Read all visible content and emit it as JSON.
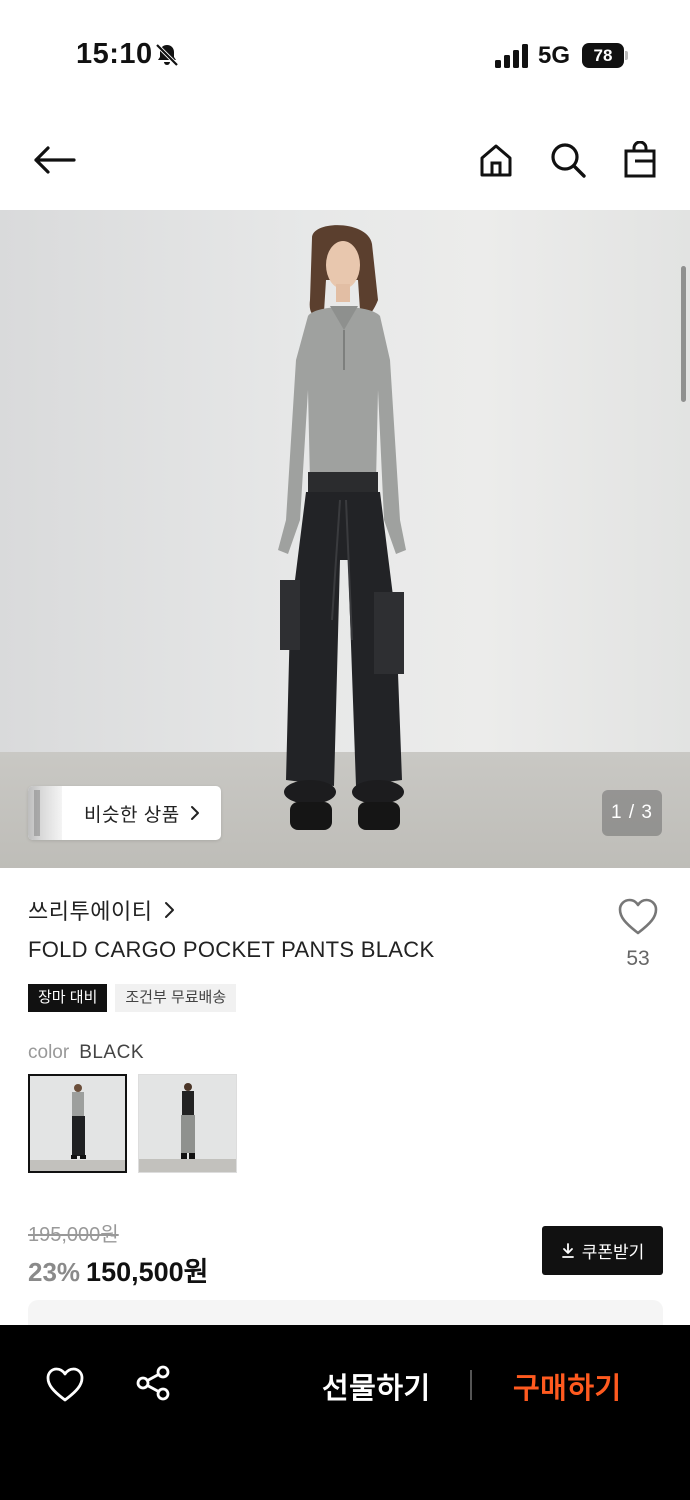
{
  "status_bar": {
    "time": "15:10",
    "network": "5G",
    "battery": "78",
    "icons": [
      "bell-off-icon",
      "signal-icon",
      "battery-icon"
    ]
  },
  "nav": {
    "icons": [
      "back-arrow-icon",
      "home-icon",
      "search-icon",
      "shopping-bag-icon"
    ]
  },
  "gallery": {
    "similar_label": "비슷한 상품",
    "page_indicator": "1 / 3"
  },
  "product": {
    "brand": "쓰리투에이티",
    "title": "FOLD CARGO POCKET PANTS BLACK",
    "like_count": "53",
    "tags": [
      "장마 대비",
      "조건부 무료배송"
    ],
    "color_label": "color",
    "color_value": "BLACK",
    "price_original": "195,000원",
    "discount": "23%",
    "price_final": "150,500원",
    "coupon_label": "쿠폰받기"
  },
  "bottom_bar": {
    "gift_label": "선물하기",
    "buy_label": "구매하기"
  },
  "colors": {
    "accent": "#ff5a1f",
    "dark": "#111111",
    "muted": "#999999"
  }
}
